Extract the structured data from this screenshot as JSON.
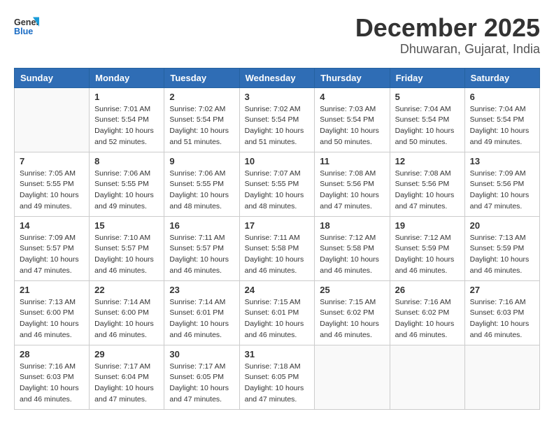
{
  "logo": {
    "line1": "General",
    "line2": "Blue"
  },
  "title": "December 2025",
  "location": "Dhuwaran, Gujarat, India",
  "days_of_week": [
    "Sunday",
    "Monday",
    "Tuesday",
    "Wednesday",
    "Thursday",
    "Friday",
    "Saturday"
  ],
  "weeks": [
    [
      {
        "day": "",
        "info": ""
      },
      {
        "day": "1",
        "info": "Sunrise: 7:01 AM\nSunset: 5:54 PM\nDaylight: 10 hours\nand 52 minutes."
      },
      {
        "day": "2",
        "info": "Sunrise: 7:02 AM\nSunset: 5:54 PM\nDaylight: 10 hours\nand 51 minutes."
      },
      {
        "day": "3",
        "info": "Sunrise: 7:02 AM\nSunset: 5:54 PM\nDaylight: 10 hours\nand 51 minutes."
      },
      {
        "day": "4",
        "info": "Sunrise: 7:03 AM\nSunset: 5:54 PM\nDaylight: 10 hours\nand 50 minutes."
      },
      {
        "day": "5",
        "info": "Sunrise: 7:04 AM\nSunset: 5:54 PM\nDaylight: 10 hours\nand 50 minutes."
      },
      {
        "day": "6",
        "info": "Sunrise: 7:04 AM\nSunset: 5:54 PM\nDaylight: 10 hours\nand 49 minutes."
      }
    ],
    [
      {
        "day": "7",
        "info": ""
      },
      {
        "day": "8",
        "info": "Sunrise: 7:06 AM\nSunset: 5:55 PM\nDaylight: 10 hours\nand 49 minutes."
      },
      {
        "day": "9",
        "info": "Sunrise: 7:06 AM\nSunset: 5:55 PM\nDaylight: 10 hours\nand 48 minutes."
      },
      {
        "day": "10",
        "info": "Sunrise: 7:07 AM\nSunset: 5:55 PM\nDaylight: 10 hours\nand 48 minutes."
      },
      {
        "day": "11",
        "info": "Sunrise: 7:08 AM\nSunset: 5:56 PM\nDaylight: 10 hours\nand 47 minutes."
      },
      {
        "day": "12",
        "info": "Sunrise: 7:08 AM\nSunset: 5:56 PM\nDaylight: 10 hours\nand 47 minutes."
      },
      {
        "day": "13",
        "info": "Sunrise: 7:09 AM\nSunset: 5:56 PM\nDaylight: 10 hours\nand 47 minutes."
      }
    ],
    [
      {
        "day": "14",
        "info": ""
      },
      {
        "day": "15",
        "info": "Sunrise: 7:10 AM\nSunset: 5:57 PM\nDaylight: 10 hours\nand 46 minutes."
      },
      {
        "day": "16",
        "info": "Sunrise: 7:11 AM\nSunset: 5:57 PM\nDaylight: 10 hours\nand 46 minutes."
      },
      {
        "day": "17",
        "info": "Sunrise: 7:11 AM\nSunset: 5:58 PM\nDaylight: 10 hours\nand 46 minutes."
      },
      {
        "day": "18",
        "info": "Sunrise: 7:12 AM\nSunset: 5:58 PM\nDaylight: 10 hours\nand 46 minutes."
      },
      {
        "day": "19",
        "info": "Sunrise: 7:12 AM\nSunset: 5:59 PM\nDaylight: 10 hours\nand 46 minutes."
      },
      {
        "day": "20",
        "info": "Sunrise: 7:13 AM\nSunset: 5:59 PM\nDaylight: 10 hours\nand 46 minutes."
      }
    ],
    [
      {
        "day": "21",
        "info": ""
      },
      {
        "day": "22",
        "info": "Sunrise: 7:14 AM\nSunset: 6:00 PM\nDaylight: 10 hours\nand 46 minutes."
      },
      {
        "day": "23",
        "info": "Sunrise: 7:14 AM\nSunset: 6:01 PM\nDaylight: 10 hours\nand 46 minutes."
      },
      {
        "day": "24",
        "info": "Sunrise: 7:15 AM\nSunset: 6:01 PM\nDaylight: 10 hours\nand 46 minutes."
      },
      {
        "day": "25",
        "info": "Sunrise: 7:15 AM\nSunset: 6:02 PM\nDaylight: 10 hours\nand 46 minutes."
      },
      {
        "day": "26",
        "info": "Sunrise: 7:16 AM\nSunset: 6:02 PM\nDaylight: 10 hours\nand 46 minutes."
      },
      {
        "day": "27",
        "info": "Sunrise: 7:16 AM\nSunset: 6:03 PM\nDaylight: 10 hours\nand 46 minutes."
      }
    ],
    [
      {
        "day": "28",
        "info": "Sunrise: 7:16 AM\nSunset: 6:03 PM\nDaylight: 10 hours\nand 46 minutes."
      },
      {
        "day": "29",
        "info": "Sunrise: 7:17 AM\nSunset: 6:04 PM\nDaylight: 10 hours\nand 47 minutes."
      },
      {
        "day": "30",
        "info": "Sunrise: 7:17 AM\nSunset: 6:05 PM\nDaylight: 10 hours\nand 47 minutes."
      },
      {
        "day": "31",
        "info": "Sunrise: 7:18 AM\nSunset: 6:05 PM\nDaylight: 10 hours\nand 47 minutes."
      },
      {
        "day": "",
        "info": ""
      },
      {
        "day": "",
        "info": ""
      },
      {
        "day": "",
        "info": ""
      }
    ]
  ],
  "week7_sunday": "Sunrise: 7:05 AM\nSunset: 5:55 PM\nDaylight: 10 hours\nand 49 minutes.",
  "week14_sunday": "Sunrise: 7:09 AM\nSunset: 5:57 PM\nDaylight: 10 hours\nand 47 minutes.",
  "week21_sunday": "Sunrise: 7:13 AM\nSunset: 6:00 PM\nDaylight: 10 hours\nand 46 minutes."
}
